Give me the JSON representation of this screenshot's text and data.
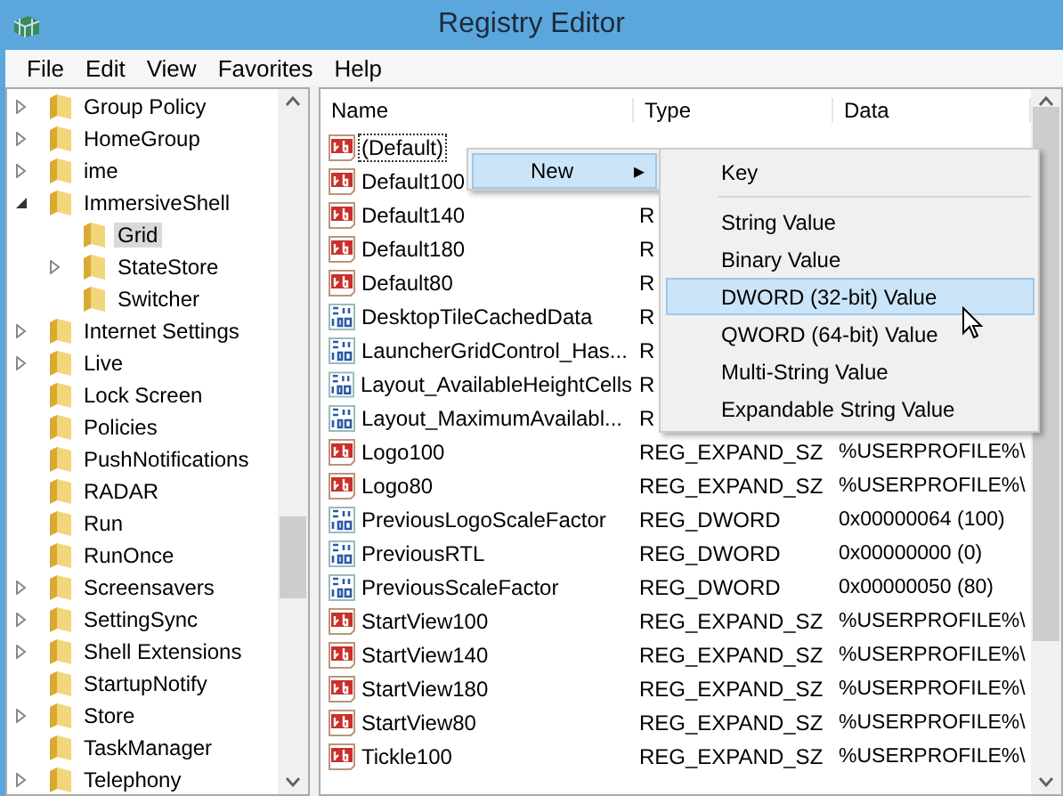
{
  "window": {
    "title": "Registry Editor"
  },
  "menu_bar": [
    "File",
    "Edit",
    "View",
    "Favorites",
    "Help"
  ],
  "tree": [
    {
      "label": "Group Policy",
      "has_children": true,
      "selected": false
    },
    {
      "label": "HomeGroup",
      "has_children": true,
      "selected": false
    },
    {
      "label": "ime",
      "has_children": true,
      "selected": false
    },
    {
      "label": "ImmersiveShell",
      "has_children": true,
      "expanded": true,
      "selected": false,
      "children": [
        {
          "label": "Grid",
          "has_children": false,
          "selected": true
        },
        {
          "label": "StateStore",
          "has_children": true,
          "selected": false
        },
        {
          "label": "Switcher",
          "has_children": false,
          "selected": false
        }
      ]
    },
    {
      "label": "Internet Settings",
      "has_children": true,
      "selected": false
    },
    {
      "label": "Live",
      "has_children": true,
      "selected": false
    },
    {
      "label": "Lock Screen",
      "has_children": false,
      "selected": false
    },
    {
      "label": "Policies",
      "has_children": false,
      "selected": false
    },
    {
      "label": "PushNotifications",
      "has_children": false,
      "selected": false
    },
    {
      "label": "RADAR",
      "has_children": false,
      "selected": false
    },
    {
      "label": "Run",
      "has_children": false,
      "selected": false
    },
    {
      "label": "RunOnce",
      "has_children": false,
      "selected": false
    },
    {
      "label": "Screensavers",
      "has_children": true,
      "selected": false
    },
    {
      "label": "SettingSync",
      "has_children": true,
      "selected": false
    },
    {
      "label": "Shell Extensions",
      "has_children": true,
      "selected": false
    },
    {
      "label": "StartupNotify",
      "has_children": false,
      "selected": false
    },
    {
      "label": "Store",
      "has_children": true,
      "selected": false
    },
    {
      "label": "TaskManager",
      "has_children": false,
      "selected": false
    },
    {
      "label": "Telephony",
      "has_children": true,
      "selected": false
    }
  ],
  "table": {
    "columns": [
      "Name",
      "Type",
      "Data"
    ],
    "rows": [
      {
        "kind": "string",
        "name": "(Default)",
        "focused": true
      },
      {
        "kind": "string",
        "name": "Default100",
        "focused": false
      },
      {
        "kind": "string",
        "name": "Default140",
        "type": "R",
        "focused": false
      },
      {
        "kind": "string",
        "name": "Default180",
        "type": "R",
        "focused": false
      },
      {
        "kind": "string",
        "name": "Default80",
        "type": "R",
        "focused": false
      },
      {
        "kind": "binary",
        "name": "DesktopTileCachedData",
        "type": "R",
        "focused": false
      },
      {
        "kind": "binary",
        "name": "LauncherGridControl_Has...",
        "type": "R",
        "focused": false
      },
      {
        "kind": "binary",
        "name": "Layout_AvailableHeightCells",
        "type": "R",
        "focused": false
      },
      {
        "kind": "binary",
        "name": "Layout_MaximumAvailabl...",
        "type": "R",
        "focused": false
      },
      {
        "kind": "string",
        "name": "Logo100",
        "type": "REG_EXPAND_SZ",
        "data": "%USERPROFILE%\\",
        "focused": false
      },
      {
        "kind": "string",
        "name": "Logo80",
        "type": "REG_EXPAND_SZ",
        "data": "%USERPROFILE%\\",
        "focused": false
      },
      {
        "kind": "binary",
        "name": "PreviousLogoScaleFactor",
        "type": "REG_DWORD",
        "data": "0x00000064 (100)",
        "focused": false
      },
      {
        "kind": "binary",
        "name": "PreviousRTL",
        "type": "REG_DWORD",
        "data": "0x00000000 (0)",
        "focused": false
      },
      {
        "kind": "binary",
        "name": "PreviousScaleFactor",
        "type": "REG_DWORD",
        "data": "0x00000050 (80)",
        "focused": false
      },
      {
        "kind": "string",
        "name": "StartView100",
        "type": "REG_EXPAND_SZ",
        "data": "%USERPROFILE%\\",
        "focused": false
      },
      {
        "kind": "string",
        "name": "StartView140",
        "type": "REG_EXPAND_SZ",
        "data": "%USERPROFILE%\\",
        "focused": false
      },
      {
        "kind": "string",
        "name": "StartView180",
        "type": "REG_EXPAND_SZ",
        "data": "%USERPROFILE%\\",
        "focused": false
      },
      {
        "kind": "string",
        "name": "StartView80",
        "type": "REG_EXPAND_SZ",
        "data": "%USERPROFILE%\\",
        "focused": false
      },
      {
        "kind": "string",
        "name": "Tickle100",
        "type": "REG_EXPAND_SZ",
        "data": "%USERPROFILE%\\",
        "focused": false
      }
    ]
  },
  "context_menu": {
    "items": [
      {
        "label": "New",
        "selected": true,
        "submenu_arrow": "▸"
      }
    ],
    "submenu": [
      {
        "label": "Key",
        "selected": false,
        "separator_after": true
      },
      {
        "label": "String Value",
        "selected": false
      },
      {
        "label": "Binary Value",
        "selected": false
      },
      {
        "label": "DWORD (32-bit) Value",
        "selected": true
      },
      {
        "label": "QWORD (64-bit) Value",
        "selected": false
      },
      {
        "label": "Multi-String Value",
        "selected": false
      },
      {
        "label": "Expandable String Value",
        "selected": false
      }
    ]
  }
}
